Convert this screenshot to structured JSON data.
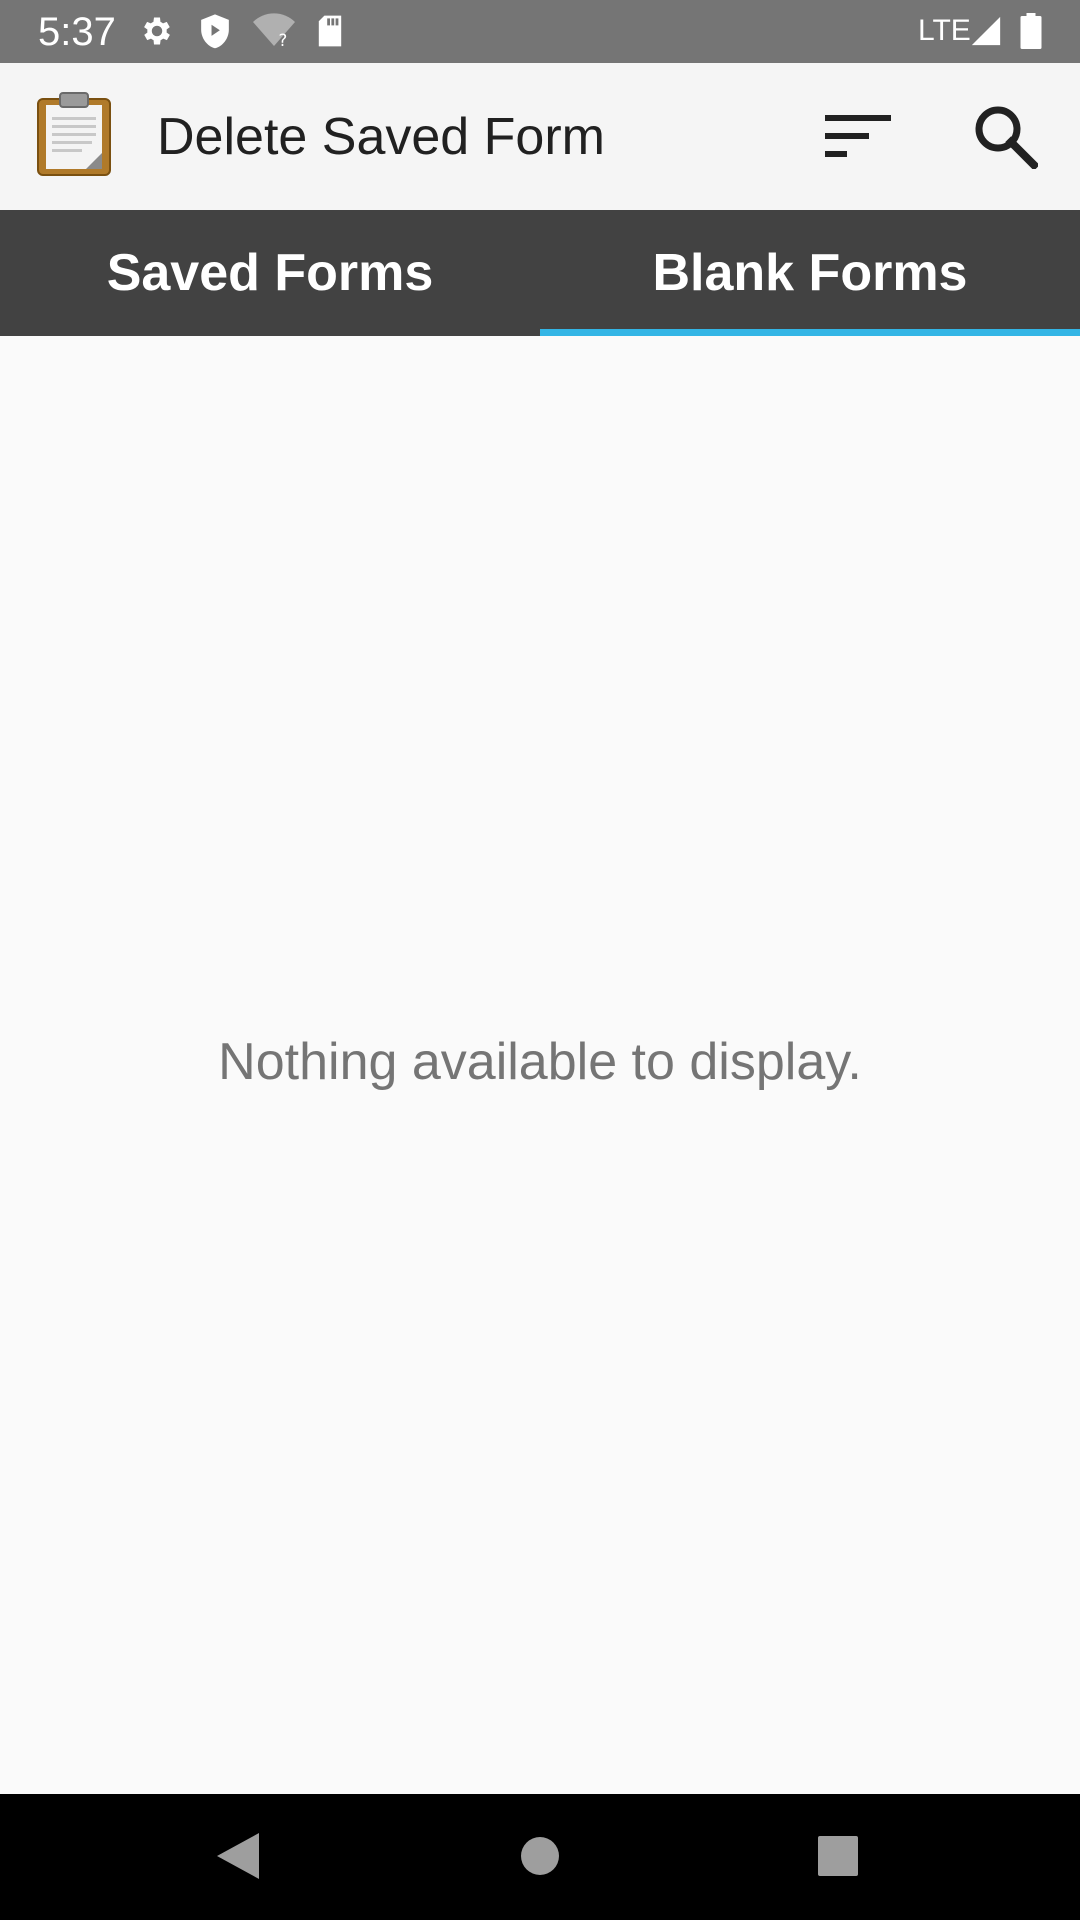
{
  "status_bar": {
    "time": "5:37",
    "network": "LTE",
    "icons": [
      "settings-icon",
      "shield-icon",
      "wifi-question-icon",
      "sd-card-icon",
      "signal-icon",
      "battery-icon"
    ]
  },
  "app_bar": {
    "title": "Delete Saved Form",
    "logo_icon": "clipboard-icon",
    "actions": [
      "sort-icon",
      "search-icon"
    ]
  },
  "tabs": [
    {
      "label": "Saved Forms",
      "selected": false
    },
    {
      "label": "Blank Forms",
      "selected": true
    }
  ],
  "content": {
    "empty_message": "Nothing available to display."
  },
  "nav_bar": {
    "buttons": [
      "back-icon",
      "home-icon",
      "recents-icon"
    ]
  },
  "colors": {
    "status_bar": "#757575",
    "app_bar": "#f5f5f5",
    "tab_bar": "#424242",
    "tab_indicator": "#33b5e5",
    "background": "#fafafa",
    "nav_bar": "#000000",
    "empty_text": "#757575"
  }
}
